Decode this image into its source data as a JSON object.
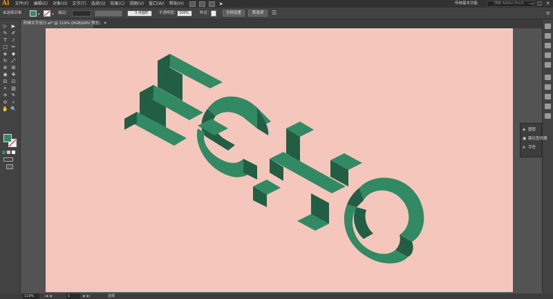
{
  "app": {
    "logo": "Ai"
  },
  "menu": [
    "文件(F)",
    "编辑(E)",
    "对象(O)",
    "文字(T)",
    "选择(S)",
    "效果(C)",
    "视图(V)",
    "窗口(W)",
    "帮助(H)"
  ],
  "workspace": "传统基本功能",
  "search_placeholder": "搜索 Adobe Stock",
  "window_controls": [
    "—",
    "□",
    "✕"
  ],
  "control": {
    "selection_label": "未选择对象",
    "stroke_label": "描边：",
    "brush_label": "3 点圆形",
    "opacity_label": "不透明度：",
    "opacity_value": "100%",
    "style_label": "样式：",
    "doc_setup_button": "文档设置",
    "preferences_button": "首选项"
  },
  "document_tab": {
    "title": "阶梯文字设计.ai* @ 119% (RGB/GPU 预览)",
    "close": "✕"
  },
  "tools": [
    "▷",
    "▶",
    "✎",
    "✐",
    "T",
    "/",
    "□",
    "✏",
    "◈",
    "◆",
    "↻",
    "⤢",
    "⊕",
    "⊞",
    "◉",
    "✥",
    "⊟",
    "⊡",
    "⌗",
    "▥",
    "✢",
    "✎",
    "⊘",
    "⌕",
    "✋",
    "🔍"
  ],
  "panel": {
    "items": [
      {
        "icon": "layers-icon",
        "label": "图层"
      },
      {
        "icon": "pathfinder-icon",
        "label": "路径查找器"
      },
      {
        "icon": "character-icon",
        "label": "字符"
      }
    ]
  },
  "status": {
    "zoom": "119%",
    "page": "1",
    "mode": "选择"
  },
  "artwork": {
    "word": "ECHO",
    "colors": {
      "top": "#318a63",
      "side": "#225e44",
      "background": "#f4c6bc"
    }
  }
}
